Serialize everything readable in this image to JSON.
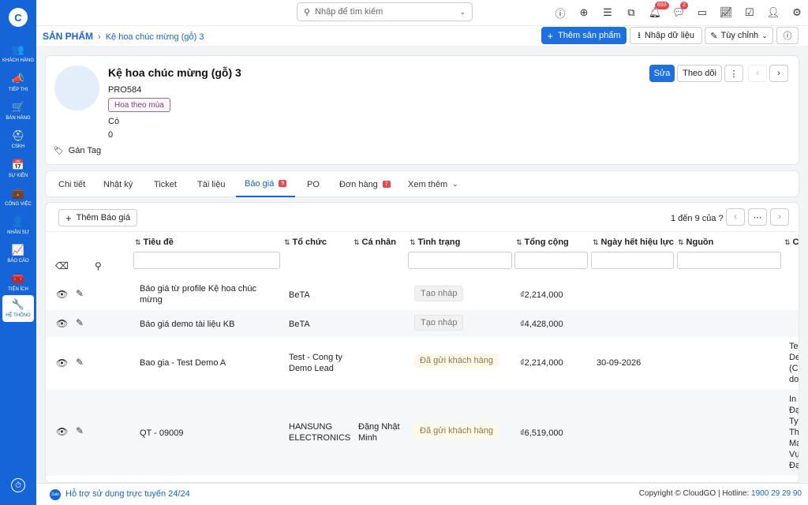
{
  "sidebar": {
    "logo": "C",
    "items": [
      {
        "label": "Khách hàng",
        "icon": "users-icon",
        "glyph": "👥"
      },
      {
        "label": "Tiếp thị",
        "icon": "megaphone-icon",
        "glyph": "📣"
      },
      {
        "label": "Bán hàng",
        "icon": "cart-icon",
        "glyph": "🛒"
      },
      {
        "label": "CSKH",
        "icon": "support-icon",
        "glyph": "⛑"
      },
      {
        "label": "Sự kiện",
        "icon": "calendar-icon",
        "glyph": "📅"
      },
      {
        "label": "Công việc",
        "icon": "briefcase-icon",
        "glyph": "💼"
      },
      {
        "label": "Nhân sự",
        "icon": "person-icon",
        "glyph": "👤"
      },
      {
        "label": "Báo cáo",
        "icon": "report-icon",
        "glyph": "📈"
      },
      {
        "label": "Tiện ích",
        "icon": "utilities-icon",
        "glyph": "🧰"
      },
      {
        "label": "Hệ thống",
        "icon": "wrench-icon",
        "glyph": "🔧"
      }
    ]
  },
  "topbar": {
    "search_placeholder": "Nhập để tìm kiếm",
    "notifications_count": "693",
    "messages_count": "2"
  },
  "breadcrumb": {
    "root": "SẢN PHẨM",
    "current": "Kệ hoa chúc mừng (gỗ) 3"
  },
  "actions": {
    "add_product": "Thêm sản phẩm",
    "import_data": "Nhập dữ liệu",
    "customize": "Tùy chỉnh"
  },
  "product": {
    "title": "Kệ hoa chúc mừng (gỗ) 3",
    "code": "PRO584",
    "category": "Hoa theo mùa",
    "field_yes": "Có",
    "field_zero": "0",
    "add_tag": "Gán Tag",
    "edit": "Sửa",
    "follow": "Theo dõi"
  },
  "tabs": [
    {
      "label": "Chi tiết"
    },
    {
      "label": "Nhật ký"
    },
    {
      "label": "Ticket"
    },
    {
      "label": "Tài liệu"
    },
    {
      "label": "Báo giá",
      "count": "9"
    },
    {
      "label": "PO"
    },
    {
      "label": "Đơn hàng",
      "count": "7"
    },
    {
      "label": "Xem thêm"
    }
  ],
  "quotes": {
    "add_label": "Thêm Báo giá",
    "pager": "1 đến 9 của ?",
    "columns": [
      "Tiêu đề",
      "Tổ chức",
      "Cá nhân",
      "Tình trạng",
      "Tổng cộng",
      "Ngày hết hiệu lực",
      "Nguồn",
      "C"
    ],
    "rows": [
      {
        "title": "Báo giá từ profile Kệ hoa chúc mừng",
        "org": "BeTA",
        "person": "",
        "status": "Tạo nháp",
        "total": "₫2,214,000",
        "expiry": "",
        "source": "",
        "extra": ""
      },
      {
        "title": "Báo giá demo tài liệu KB",
        "org": "BeTA",
        "person": "",
        "status": "Tạo nháp",
        "total": "₫4,428,000",
        "expiry": "",
        "source": "",
        "extra": ""
      },
      {
        "title": "Bao gia - Test Demo A",
        "org": "Test - Cong ty Demo Lead",
        "person": "",
        "status": "Đã gửi khách hàng",
        "total": "₫2,214,000",
        "expiry": "30-09-2026",
        "source": "",
        "extra": "Tes De (Cl do"
      },
      {
        "title": "QT - 09009",
        "org": "HANSUNG ELECTRONICS",
        "person": "Đặng Nhật Minh",
        "status": "Đã gửi khách hàng",
        "total": "₫6,519,000",
        "expiry": "",
        "source": "",
        "extra": "In Đạ Ty Th Mạ Vụ Đạ"
      }
    ]
  },
  "footer": {
    "zalo": "Zalo",
    "support": "Hỗ trợ sử dụng trực tuyến 24/24",
    "copyright": "Copyright © CloudGO | Hotline: ",
    "hotline": "1900 29 29 90"
  }
}
